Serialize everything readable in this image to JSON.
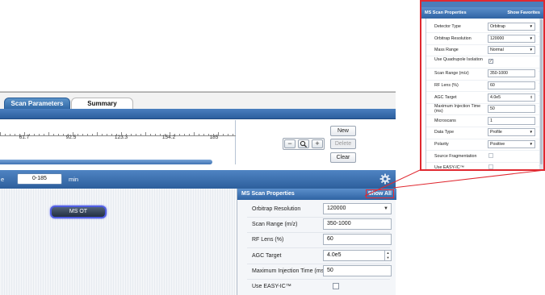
{
  "tabs": {
    "scan_parameters": "Scan Parameters",
    "summary": "Summary"
  },
  "timeline": {
    "ticks": [
      "61.7",
      "92.5",
      "123.3",
      "154.2",
      "185"
    ],
    "progress_fraction": 0.9
  },
  "zoom": {
    "minus": "−",
    "magnifier_icon": "magnifier-icon",
    "plus": "+"
  },
  "buttons": {
    "new": "New",
    "delete": "Delete",
    "clear": "Clear"
  },
  "range": {
    "label_fragment": "e",
    "value": "0-185",
    "unit": "min"
  },
  "gear_icon": "gear-icon",
  "method_node": {
    "label": "MS OT"
  },
  "properties": {
    "header": "MS Scan Properties",
    "show_all": "Show All",
    "rows": [
      {
        "label": "Orbitrap Resolution",
        "value": "120000",
        "type": "select"
      },
      {
        "label": "Scan Range (m/z)",
        "value": "350-1000",
        "type": "text"
      },
      {
        "label": "RF Lens (%)",
        "value": "60",
        "type": "text"
      },
      {
        "label": "AGC Target",
        "value": "4.0e5",
        "type": "spinner"
      },
      {
        "label": "Maximum Injection Time (ms)",
        "value": "50",
        "type": "text"
      },
      {
        "label": "Use EASY-IC™",
        "value": "",
        "type": "checkbox"
      }
    ]
  },
  "callout": {
    "header": "MS Scan Properties",
    "show_favorites": "Show Favorites",
    "rows": [
      {
        "label": "Detector Type",
        "value": "Orbitrap",
        "type": "select",
        "favorite": false
      },
      {
        "label": "Orbitrap Resolution",
        "value": "120000",
        "type": "select",
        "favorite": true
      },
      {
        "label": "Mass Range",
        "value": "Normal",
        "type": "select",
        "favorite": false
      },
      {
        "label": "Use Quadrupole Isolation",
        "value": "✓",
        "type": "checkbox",
        "favorite": false
      },
      {
        "label": "Scan Range (m/z)",
        "value": "350-1000",
        "type": "text",
        "favorite": true
      },
      {
        "label": "RF Lens (%)",
        "value": "60",
        "type": "text",
        "favorite": true
      },
      {
        "label": "AGC Target",
        "value": "4.0e5",
        "type": "spinner",
        "favorite": true
      },
      {
        "label": "Maximum Injection Time (ms)",
        "value": "50",
        "type": "text",
        "favorite": true
      },
      {
        "label": "Microscans",
        "value": "1",
        "type": "text",
        "favorite": false
      },
      {
        "label": "Data Type",
        "value": "Profile",
        "type": "select",
        "favorite": false
      },
      {
        "label": "Polarity",
        "value": "Positive",
        "type": "select",
        "favorite": false
      },
      {
        "label": "Source Fragmentation",
        "value": "",
        "type": "checkbox",
        "favorite": false
      },
      {
        "label": "Use EASY-IC™",
        "value": "",
        "type": "checkbox",
        "favorite": true
      }
    ]
  },
  "colors": {
    "accent_blue": "#2f63a3",
    "callout_border": "#e02830",
    "favorite_star": "#3f7fd0",
    "non_favorite_star": "#c7ccd4",
    "node_border": "#4f5de2"
  }
}
